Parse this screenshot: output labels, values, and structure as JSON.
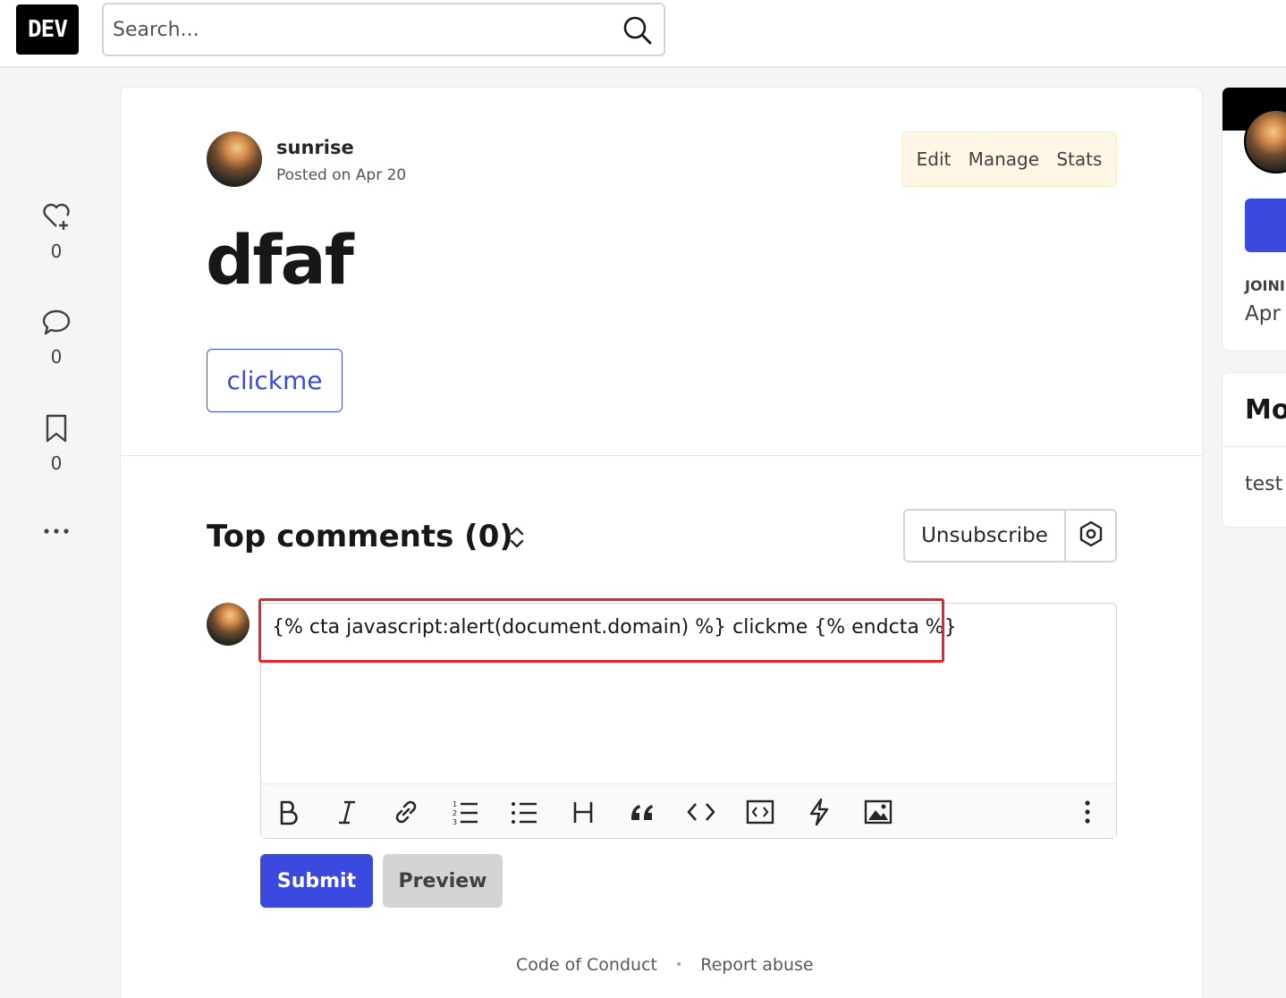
{
  "header": {
    "logo": "DEV",
    "search_placeholder": "Search..."
  },
  "rail": {
    "reactions_count": "0",
    "comments_count": "0",
    "bookmarks_count": "0"
  },
  "article": {
    "author": "sunrise",
    "posted": "Posted on Apr 20",
    "actions": [
      "Edit",
      "Manage",
      "Stats"
    ],
    "title": "dfaf",
    "cta_label": "clickme"
  },
  "comments": {
    "title": "Top comments (0)",
    "unsubscribe": "Unsubscribe",
    "draft": "{% cta javascript:alert(document.domain) %} clickme {% endcta %}",
    "submit": "Submit",
    "preview": "Preview"
  },
  "footer": {
    "code_of_conduct": "Code of Conduct",
    "report_abuse": "Report abuse"
  },
  "sidebar": {
    "joined_label": "JOINI",
    "joined_value": "Apr",
    "more_title": "Mo",
    "more_item": "test"
  },
  "colors": {
    "accent": "#3b49df",
    "highlight": "#e8232a",
    "owner_actions_bg": "#fff7e6"
  }
}
